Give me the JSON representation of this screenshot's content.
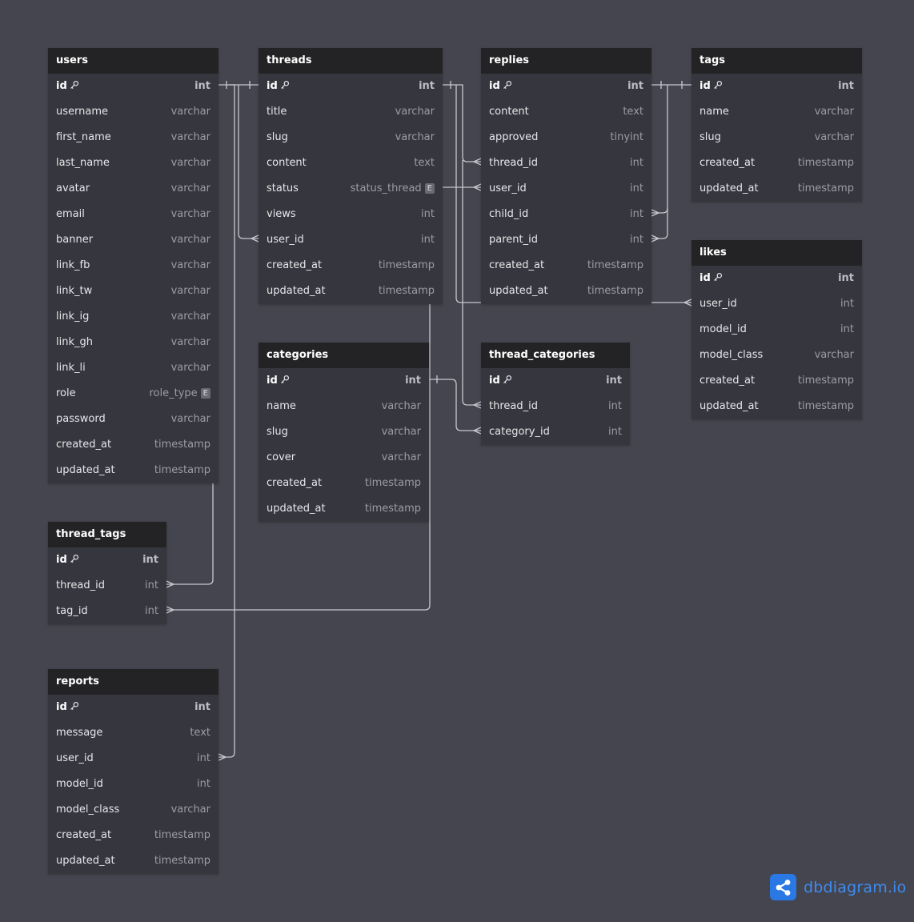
{
  "diagram": {
    "tables": [
      {
        "name": "users",
        "columns": [
          {
            "name": "id",
            "type": "int",
            "pk": true
          },
          {
            "name": "username",
            "type": "varchar"
          },
          {
            "name": "first_name",
            "type": "varchar"
          },
          {
            "name": "last_name",
            "type": "varchar"
          },
          {
            "name": "avatar",
            "type": "varchar"
          },
          {
            "name": "email",
            "type": "varchar"
          },
          {
            "name": "banner",
            "type": "varchar"
          },
          {
            "name": "link_fb",
            "type": "varchar"
          },
          {
            "name": "link_tw",
            "type": "varchar"
          },
          {
            "name": "link_ig",
            "type": "varchar"
          },
          {
            "name": "link_gh",
            "type": "varchar"
          },
          {
            "name": "link_li",
            "type": "varchar"
          },
          {
            "name": "role",
            "type": "role_type",
            "enum": true
          },
          {
            "name": "password",
            "type": "varchar"
          },
          {
            "name": "created_at",
            "type": "timestamp"
          },
          {
            "name": "updated_at",
            "type": "timestamp"
          }
        ]
      },
      {
        "name": "threads",
        "columns": [
          {
            "name": "id",
            "type": "int",
            "pk": true
          },
          {
            "name": "title",
            "type": "varchar"
          },
          {
            "name": "slug",
            "type": "varchar"
          },
          {
            "name": "content",
            "type": "text"
          },
          {
            "name": "status",
            "type": "status_thread",
            "enum": true
          },
          {
            "name": "views",
            "type": "int"
          },
          {
            "name": "user_id",
            "type": "int"
          },
          {
            "name": "created_at",
            "type": "timestamp"
          },
          {
            "name": "updated_at",
            "type": "timestamp"
          }
        ]
      },
      {
        "name": "replies",
        "columns": [
          {
            "name": "id",
            "type": "int",
            "pk": true
          },
          {
            "name": "content",
            "type": "text"
          },
          {
            "name": "approved",
            "type": "tinyint"
          },
          {
            "name": "thread_id",
            "type": "int"
          },
          {
            "name": "user_id",
            "type": "int"
          },
          {
            "name": "child_id",
            "type": "int"
          },
          {
            "name": "parent_id",
            "type": "int"
          },
          {
            "name": "created_at",
            "type": "timestamp"
          },
          {
            "name": "updated_at",
            "type": "timestamp"
          }
        ]
      },
      {
        "name": "tags",
        "columns": [
          {
            "name": "id",
            "type": "int",
            "pk": true
          },
          {
            "name": "name",
            "type": "varchar"
          },
          {
            "name": "slug",
            "type": "varchar"
          },
          {
            "name": "created_at",
            "type": "timestamp"
          },
          {
            "name": "updated_at",
            "type": "timestamp"
          }
        ]
      },
      {
        "name": "likes",
        "columns": [
          {
            "name": "id",
            "type": "int",
            "pk": true
          },
          {
            "name": "user_id",
            "type": "int"
          },
          {
            "name": "model_id",
            "type": "int"
          },
          {
            "name": "model_class",
            "type": "varchar"
          },
          {
            "name": "created_at",
            "type": "timestamp"
          },
          {
            "name": "updated_at",
            "type": "timestamp"
          }
        ]
      },
      {
        "name": "categories",
        "columns": [
          {
            "name": "id",
            "type": "int",
            "pk": true
          },
          {
            "name": "name",
            "type": "varchar"
          },
          {
            "name": "slug",
            "type": "varchar"
          },
          {
            "name": "cover",
            "type": "varchar"
          },
          {
            "name": "created_at",
            "type": "timestamp"
          },
          {
            "name": "updated_at",
            "type": "timestamp"
          }
        ]
      },
      {
        "name": "thread_categories",
        "columns": [
          {
            "name": "id",
            "type": "int",
            "pk": true
          },
          {
            "name": "thread_id",
            "type": "int"
          },
          {
            "name": "category_id",
            "type": "int"
          }
        ]
      },
      {
        "name": "thread_tags",
        "columns": [
          {
            "name": "id",
            "type": "int",
            "pk": true
          },
          {
            "name": "thread_id",
            "type": "int"
          },
          {
            "name": "tag_id",
            "type": "int"
          }
        ]
      },
      {
        "name": "reports",
        "columns": [
          {
            "name": "id",
            "type": "int",
            "pk": true
          },
          {
            "name": "message",
            "type": "text"
          },
          {
            "name": "user_id",
            "type": "int"
          },
          {
            "name": "model_id",
            "type": "int"
          },
          {
            "name": "model_class",
            "type": "varchar"
          },
          {
            "name": "created_at",
            "type": "timestamp"
          },
          {
            "name": "updated_at",
            "type": "timestamp"
          }
        ]
      }
    ],
    "enum_badge": "E",
    "colors": {
      "canvas": "#45454f",
      "table_body": "#36363e",
      "table_header": "#232325",
      "relation_line": "#c8c8d0",
      "brand_blue": "#2a78e4"
    }
  },
  "brand": {
    "name": "dbdiagram",
    "suffix": ".io",
    "icon": "share-nodes-icon"
  }
}
